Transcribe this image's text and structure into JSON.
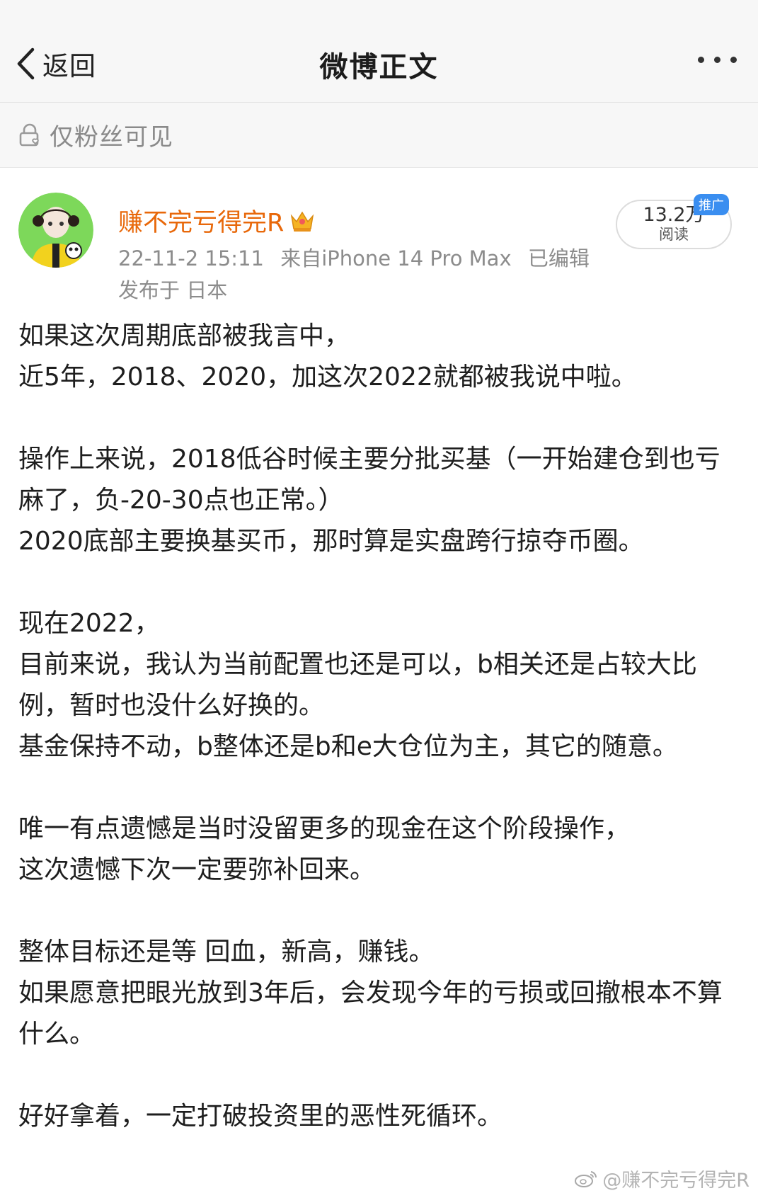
{
  "nav": {
    "back_label": "返回",
    "title": "微博正文"
  },
  "visibility": {
    "label": "仅粉丝可见"
  },
  "author": {
    "name": "赚不完亏得完R",
    "date": "22-11-2 15:11",
    "source": "来自iPhone 14 Pro Max",
    "edited": "已编辑",
    "location": "发布于 日本"
  },
  "reads": {
    "count": "13.2万",
    "label": "阅读",
    "badge": "推广"
  },
  "post": {
    "paragraphs": [
      [
        "如果这次周期底部被我言中，",
        "近5年，2018、2020，加这次2022就都被我说中啦。"
      ],
      [
        "操作上来说，2018低谷时候主要分批买基（一开始建仓到也亏麻了，负-20-30点也正常。）",
        "2020底部主要换基买币，那时算是实盘跨行掠夺币圈。"
      ],
      [
        "现在2022，",
        "目前来说，我认为当前配置也还是可以，b相关还是占较大比例，暂时也没什么好换的。",
        "基金保持不动，b整体还是b和e大仓位为主，其它的随意。"
      ],
      [
        "唯一有点遗憾是当时没留更多的现金在这个阶段操作，",
        "这次遗憾下次一定要弥补回来。"
      ],
      [
        "整体目标还是等 回血，新高，赚钱。",
        "如果愿意把眼光放到3年后，会发现今年的亏损或回撤根本不算什么。"
      ],
      [
        "好好拿着，一定打破投资里的恶性死循环。"
      ]
    ]
  },
  "watermark": {
    "text": "@赚不完亏得完R"
  },
  "colors": {
    "username": "#e8680a",
    "meta": "#8c8c8c",
    "nav_bg": "#f7f7f7",
    "badge": "#3a8ef0"
  }
}
